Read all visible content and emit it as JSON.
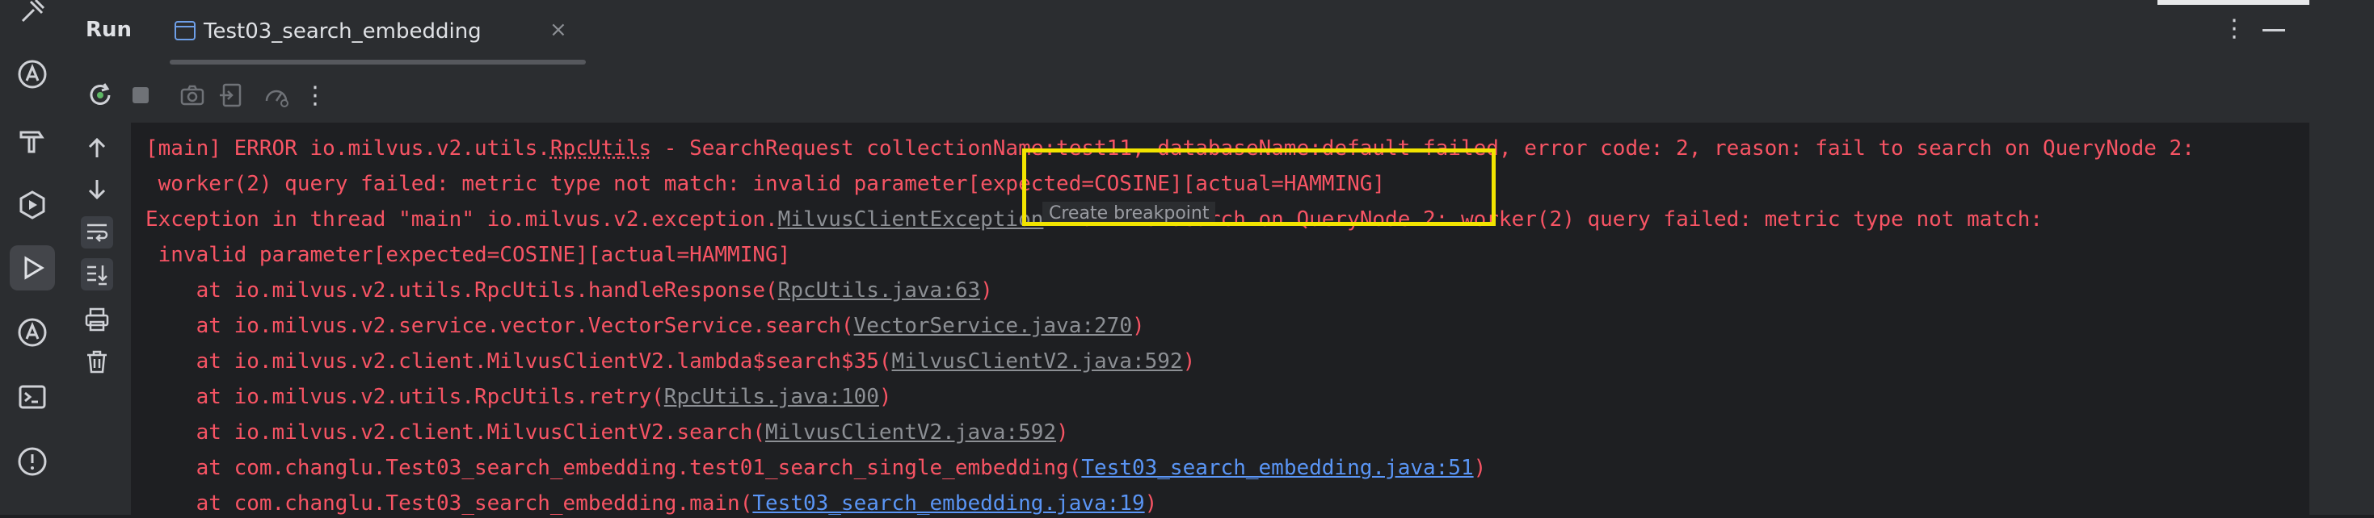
{
  "header": {
    "run_title": "Run",
    "tab_label": "Test03_search_embedding",
    "tab_close": "×",
    "more": "⋮"
  },
  "toolbar": {
    "more": "⋮"
  },
  "console": {
    "line1_prefix": "[main] ERROR io.milvus.v2.utils.",
    "line1_class": "RpcUtils",
    "line1_suffix": " - SearchRequest collectionName:test11, databaseName:default failed, error code: 2, reason: fail to search on QueryNode 2:",
    "line2": " worker(2) query failed: metric type not match: invalid parameter[expected=COSINE][actual=HAMMING]",
    "line3_prefix": "Exception in thread \"main\" io.milvus.v2.exception.",
    "line3_class": "MilvusClientException",
    "line3_suffix": ": fail to search on QueryNode 2: worker(2) query failed: metric type not match:",
    "line4": " invalid parameter[expected=COSINE][actual=HAMMING]",
    "frames": [
      {
        "text": "    at io.milvus.v2.utils.RpcUtils.handleResponse(",
        "link": "RpcUtils.java:63",
        "tail": ")",
        "kind": "gray"
      },
      {
        "text": "    at io.milvus.v2.service.vector.VectorService.search(",
        "link": "VectorService.java:270",
        "tail": ")",
        "kind": "gray"
      },
      {
        "text": "    at io.milvus.v2.client.MilvusClientV2.lambda$search$35(",
        "link": "MilvusClientV2.java:592",
        "tail": ")",
        "kind": "gray"
      },
      {
        "text": "    at io.milvus.v2.utils.RpcUtils.retry(",
        "link": "RpcUtils.java:100",
        "tail": ")",
        "kind": "gray"
      },
      {
        "text": "    at io.milvus.v2.client.MilvusClientV2.search(",
        "link": "MilvusClientV2.java:592",
        "tail": ")",
        "kind": "gray"
      },
      {
        "text": "    at com.changlu.Test03_search_embedding.test01_search_single_embedding(",
        "link": "Test03_search_embedding.java:51",
        "tail": ")",
        "kind": "blue"
      },
      {
        "text": "    at com.changlu.Test03_search_embedding.main(",
        "link": "Test03_search_embedding.java:19",
        "tail": ")",
        "kind": "blue"
      }
    ]
  },
  "tooltip": {
    "label": "Create breakpoint"
  },
  "colors": {
    "background": "#1e1f22",
    "panel": "#2b2d30",
    "error_text": "#f75464",
    "project_link": "#5a95f5",
    "library_link": "#8c8f94",
    "highlight": "#f2e400",
    "rerun_green": "#5fb865"
  },
  "icons": {
    "activity_bar": [
      "tools-icon",
      "ai-assistant-icon",
      "build-hammer-icon",
      "services-icon",
      "run-icon",
      "ai-assistant-icon-2",
      "terminal-icon",
      "problems-icon"
    ],
    "toolbar": [
      "rerun-icon",
      "stop-icon",
      "camera-icon",
      "export-icon",
      "dashboard-icon",
      "more-icon"
    ],
    "console_tools": [
      "arrow-up-icon",
      "arrow-down-icon",
      "soft-wrap-icon",
      "scroll-to-end-icon",
      "print-icon",
      "trash-icon"
    ]
  }
}
